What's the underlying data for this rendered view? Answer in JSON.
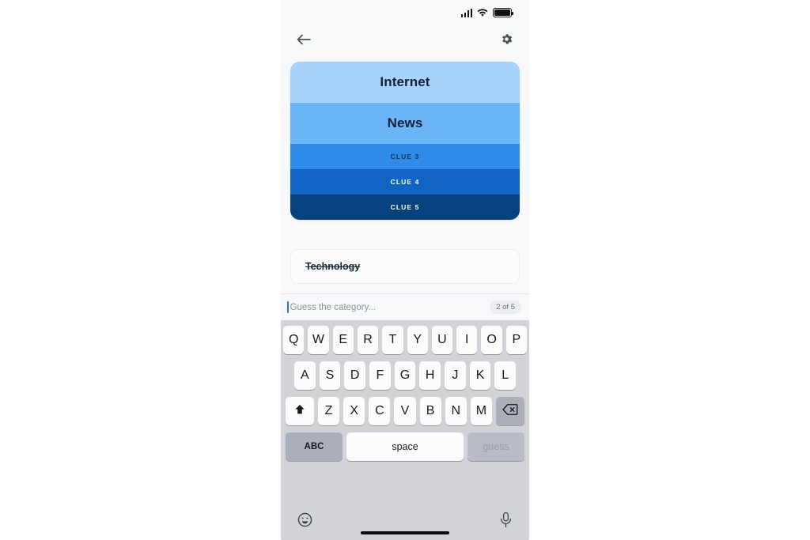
{
  "statusbar": {
    "signal_icon": "cellular-signal-icon",
    "wifi_icon": "wifi-icon",
    "battery_icon": "battery-full-icon"
  },
  "navbar": {
    "back_icon": "back-arrow-icon",
    "settings_icon": "gear-icon"
  },
  "clue_stack": {
    "clues": [
      {
        "label": "Internet",
        "state": "revealed",
        "bg": "#a8d2fb",
        "color": "#14213a"
      },
      {
        "label": "News",
        "state": "revealed",
        "bg": "#6cb4f8",
        "color": "#14213a"
      },
      {
        "label": "CLUE 3",
        "state": "locked",
        "bg": "#2f8ae8",
        "color": "#143252"
      },
      {
        "label": "CLUE 4",
        "state": "locked",
        "bg": "#0f64c4",
        "color": "#ffffff"
      },
      {
        "label": "CLUE 5",
        "state": "locked",
        "bg": "#07427e",
        "color": "#ffffff"
      }
    ]
  },
  "guesses": {
    "wrong_guess": "Technology"
  },
  "input": {
    "placeholder": "Guess the category...",
    "value": "",
    "counter": "2 of 5"
  },
  "keyboard": {
    "row1": [
      "Q",
      "W",
      "E",
      "R",
      "T",
      "Y",
      "U",
      "I",
      "O",
      "P"
    ],
    "row2": [
      "A",
      "S",
      "D",
      "F",
      "G",
      "H",
      "J",
      "K",
      "L"
    ],
    "row3": [
      "Z",
      "X",
      "C",
      "V",
      "B",
      "N",
      "M"
    ],
    "shift_icon": "shift-icon",
    "backspace_icon": "backspace-icon",
    "abc_label": "ABC",
    "space_label": "space",
    "guess_label": "guess",
    "emoji_icon": "emoji-smiley-icon",
    "mic_icon": "microphone-icon"
  }
}
